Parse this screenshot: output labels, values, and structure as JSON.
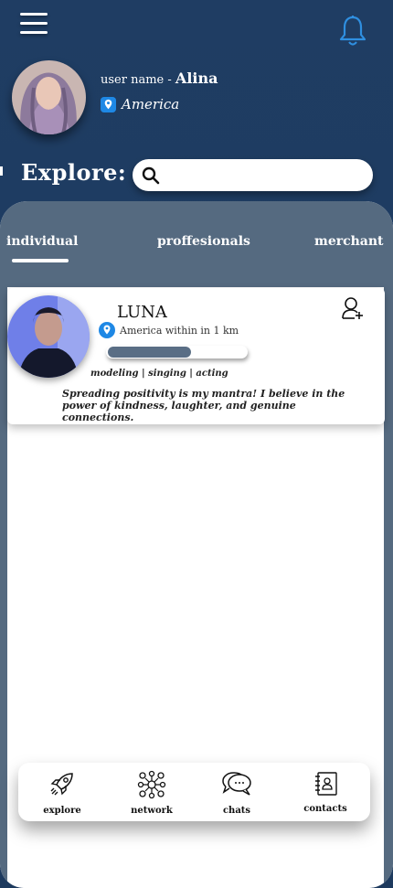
{
  "header": {
    "username_prefix": "user name -",
    "username": "Alina",
    "location": "America",
    "explore_title": "Explore:",
    "search_placeholder": ""
  },
  "tabs": [
    {
      "label": "individual",
      "active": true
    },
    {
      "label": "proffesionals",
      "active": false
    },
    {
      "label": "merchant",
      "active": false
    }
  ],
  "profile_card": {
    "name": "LUNA",
    "location": "America  within in 1 km",
    "progress": 0.6,
    "tags": "modeling | singing | acting",
    "bio": "Spreading positivity is my mantra! I believe in the power of kindness, laughter, and genuine connections."
  },
  "bottom_nav": [
    {
      "label": "explore",
      "icon": "rocket-icon"
    },
    {
      "label": "network",
      "icon": "network-icon"
    },
    {
      "label": "chats",
      "icon": "chat-icon"
    },
    {
      "label": "contacts",
      "icon": "contacts-icon"
    }
  ],
  "colors": {
    "header_bg": "#1f3d63",
    "panel_bg": "#556a80",
    "accent_blue": "#1e88e5",
    "bell": "#2f8fe0"
  }
}
